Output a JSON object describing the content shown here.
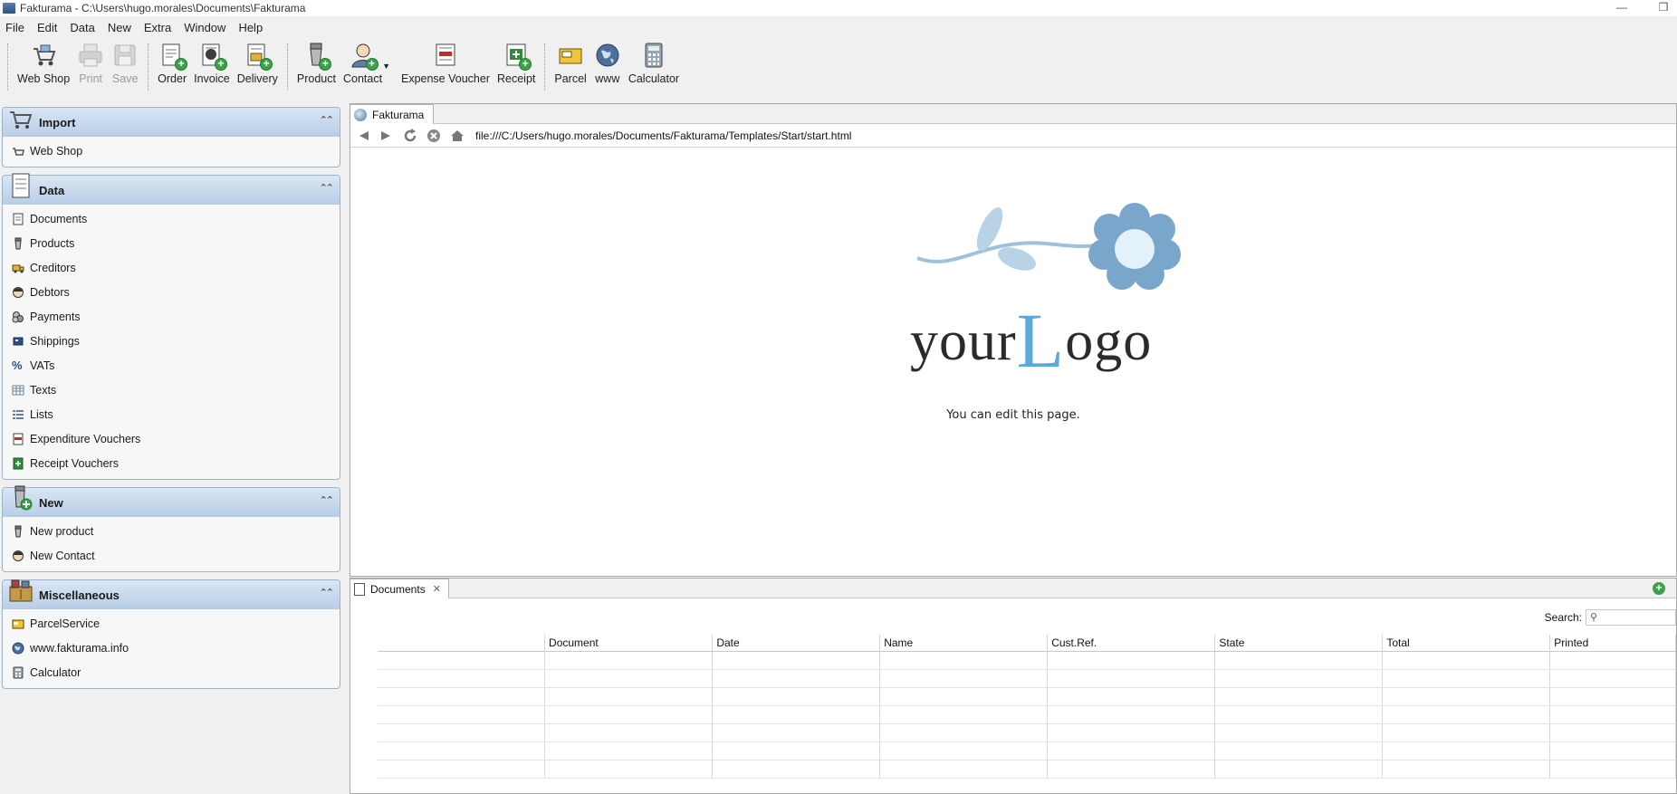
{
  "window": {
    "title": "Fakturama - C:\\Users\\hugo.morales\\Documents\\Fakturama"
  },
  "menu": [
    "File",
    "Edit",
    "Data",
    "New",
    "Extra",
    "Window",
    "Help"
  ],
  "toolbar": {
    "webshop": "Web Shop",
    "print": "Print",
    "save": "Save",
    "order": "Order",
    "invoice": "Invoice",
    "delivery": "Delivery",
    "product": "Product",
    "contact": "Contact",
    "expense_voucher": "Expense Voucher",
    "receipt": "Receipt",
    "parcel": "Parcel",
    "www": "www",
    "calculator": "Calculator"
  },
  "sidebar": {
    "import": {
      "title": "Import",
      "items": [
        "Web Shop"
      ]
    },
    "data": {
      "title": "Data",
      "items": [
        "Documents",
        "Products",
        "Creditors",
        "Debtors",
        "Payments",
        "Shippings",
        "VATs",
        "Texts",
        "Lists",
        "Expenditure Vouchers",
        "Receipt Vouchers"
      ]
    },
    "new": {
      "title": "New",
      "items": [
        "New product",
        "New Contact"
      ]
    },
    "misc": {
      "title": "Miscellaneous",
      "items": [
        "ParcelService",
        "www.fakturama.info",
        "Calculator"
      ]
    }
  },
  "editor": {
    "tab": "Fakturama",
    "url": "file:///C:/Users/hugo.morales/Documents/Fakturama/Templates/Start/start.html",
    "logo_part1": "your",
    "logo_L": "L",
    "logo_part2": "ogo",
    "message": "You can edit this page."
  },
  "documents": {
    "tab": "Documents",
    "search_label": "Search:",
    "columns": [
      "",
      "Document",
      "Date",
      "Name",
      "Cust.Ref.",
      "State",
      "Total",
      "Printed"
    ]
  },
  "colors": {
    "accent": "#b7cde6",
    "logo_blue": "#5aa9d8",
    "flower": "#7aa6cc"
  }
}
